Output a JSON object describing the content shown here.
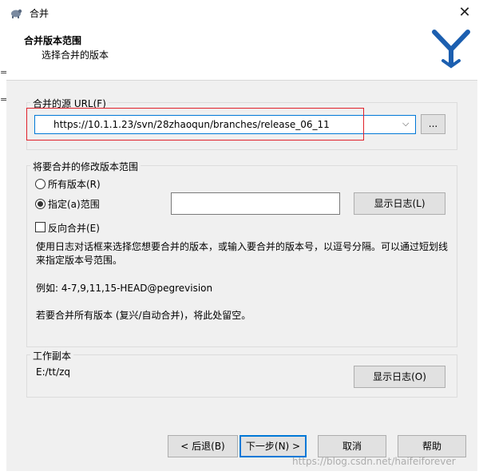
{
  "window": {
    "title": "合并"
  },
  "header": {
    "title": "合并版本范围",
    "subtitle": "选择合并的版本"
  },
  "source_url": {
    "label": "合并的源 URL(F)",
    "value": "https://10.1.1.23/svn/28zhaoqun/branches/release_06_11",
    "browse_label": "..."
  },
  "revision_range": {
    "group_label": "将要合并的修改版本范围",
    "all_revisions_label": "所有版本(R)",
    "specific_range_label": "指定(a)范围",
    "range_value": "",
    "show_log_label": "显示日志(L)",
    "reverse_merge_label": "反向合并(E)",
    "help_text": "使用日志对话框来选择您想要合并的版本，或输入要合并的版本号，以逗号分隔。可以通过短划线来指定版本号范围。",
    "example_text": "例如: 4-7,9,11,15-HEAD@pegrevision",
    "blank_note": "若要合并所有版本 (复兴/自动合并)，将此处留空。"
  },
  "working_copy": {
    "group_label": "工作副本",
    "path": "E:/tt/zq",
    "show_log_label": "显示日志(O)"
  },
  "footer": {
    "back_label": "< 后退(B)",
    "next_label": "下一步(N) >",
    "cancel_label": "取消",
    "help_label": "帮助"
  },
  "watermark": "https://blog.csdn.net/haifeiforever",
  "colors": {
    "accent": "#0078d7",
    "highlight_box": "#e0202a",
    "panel": "#f0f0f0"
  }
}
